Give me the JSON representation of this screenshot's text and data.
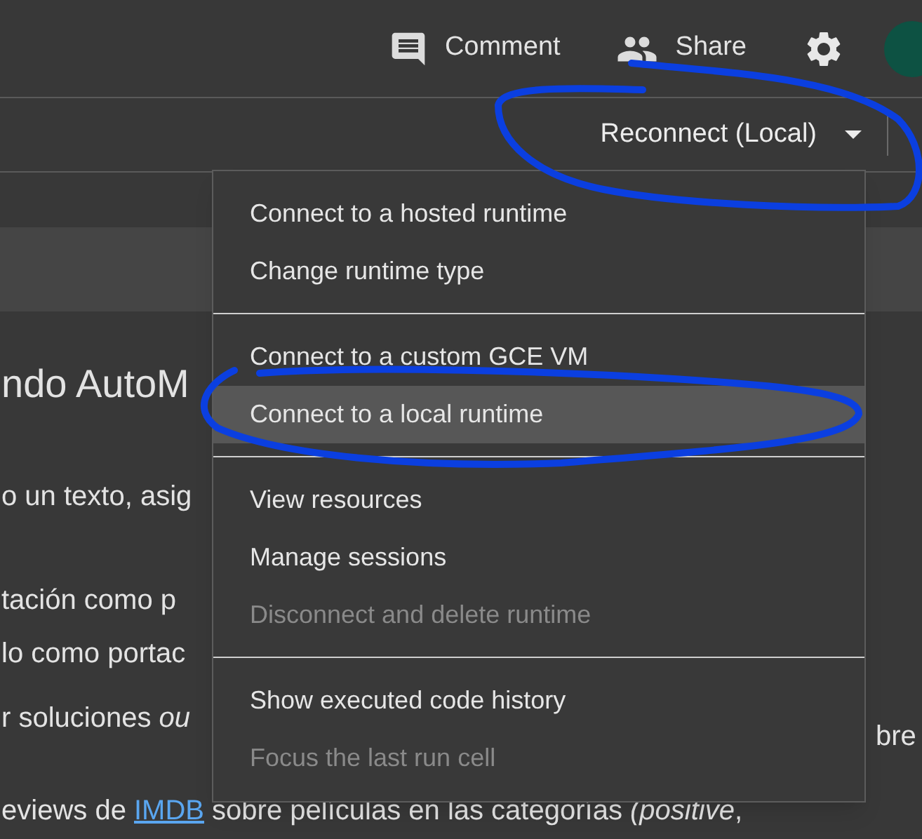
{
  "toolbar": {
    "buttons": [
      {
        "kind": "comment",
        "label": "Comment"
      },
      {
        "kind": "share",
        "label": "Share"
      },
      {
        "kind": "settings"
      }
    ]
  },
  "runtime": {
    "label": "Reconnect (Local)"
  },
  "menu": {
    "groups": [
      [
        {
          "label": "Connect to a hosted runtime",
          "selected": false,
          "disabled": false
        },
        {
          "label": "Change runtime type",
          "selected": false,
          "disabled": false
        }
      ],
      [
        {
          "label": "Connect to a custom GCE VM",
          "selected": false,
          "disabled": false
        },
        {
          "label": "Connect to a local runtime",
          "selected": true,
          "disabled": false
        }
      ],
      [
        {
          "label": "View resources",
          "selected": false,
          "disabled": false
        },
        {
          "label": "Manage sessions",
          "selected": false,
          "disabled": false
        },
        {
          "label": "Disconnect and delete runtime",
          "selected": false,
          "disabled": true
        }
      ],
      [
        {
          "label": "Show executed code history",
          "selected": false,
          "disabled": false
        },
        {
          "label": "Focus the last run cell",
          "selected": false,
          "disabled": true
        }
      ]
    ]
  },
  "notebook": {
    "heading": "ndo AutoM",
    "lines": [
      "o un texto, asig",
      "tación como p",
      "lo como portac",
      "r soluciones *ou*"
    ],
    "right_fragment": "bre",
    "last_line": [
      {
        "kind": "text",
        "text": "eviews de "
      },
      {
        "kind": "link",
        "text": "IMDB"
      },
      {
        "kind": "text",
        "text": " sobre películas en las categorías *(positive*,"
      }
    ]
  }
}
